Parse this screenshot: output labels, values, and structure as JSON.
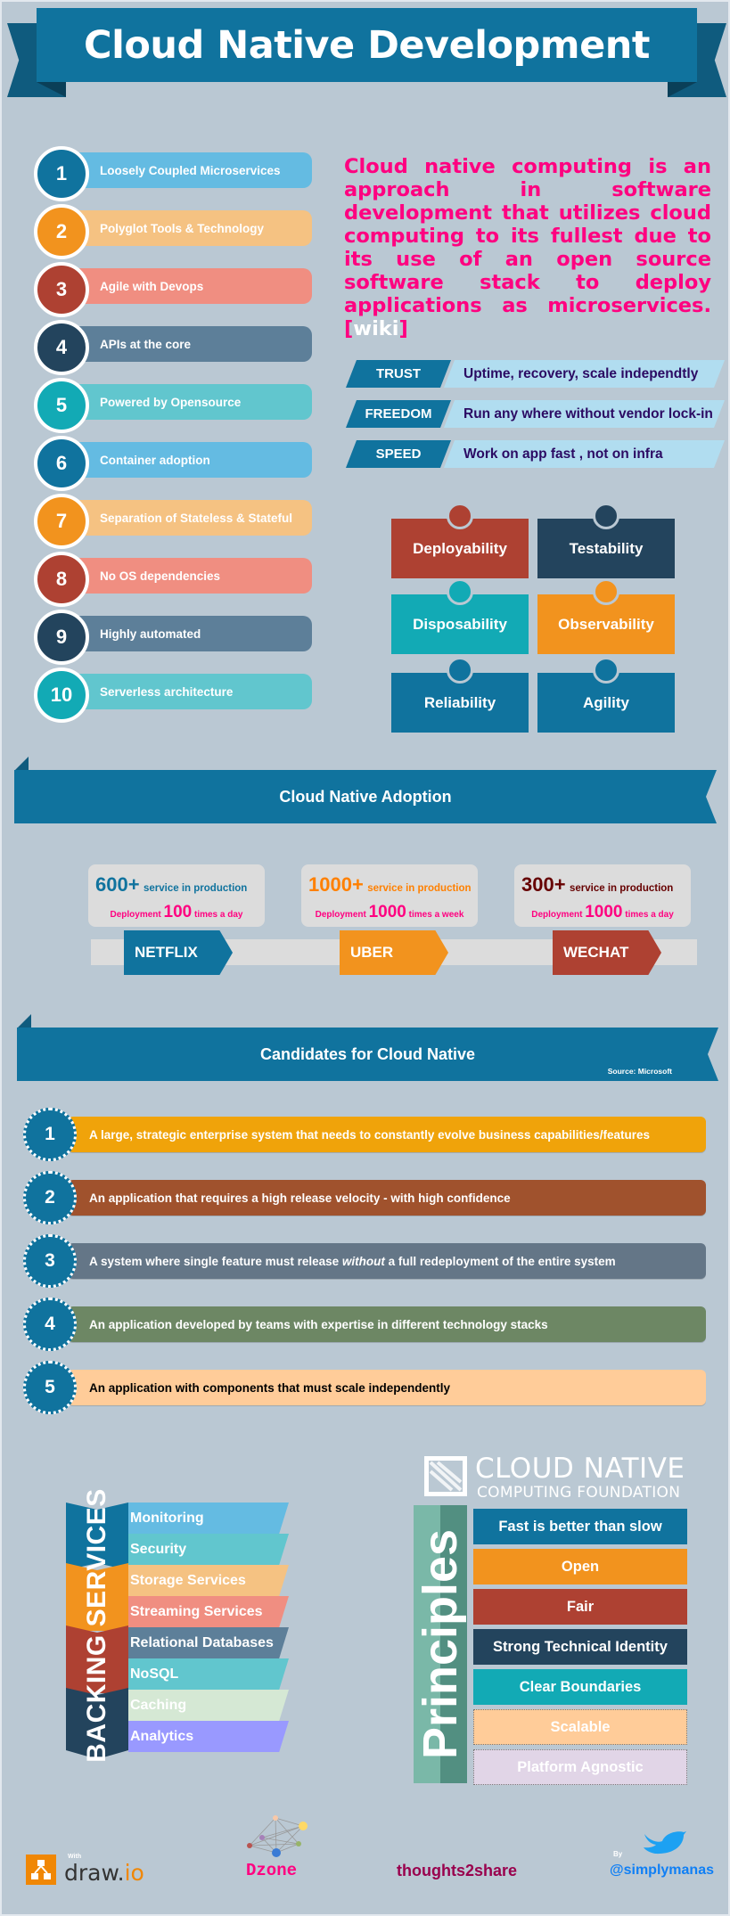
{
  "title": "Cloud Native Development",
  "traits": [
    {
      "num": "1",
      "label": "Loosely Coupled Microservices",
      "circle": "#10739e",
      "bar": "#64bbe2"
    },
    {
      "num": "2",
      "label": "Polyglot Tools & Technology",
      "circle": "#f2931e",
      "bar": "#f5c282"
    },
    {
      "num": "3",
      "label": "Agile with Devops",
      "circle": "#ae4132",
      "bar": "#f08e81"
    },
    {
      "num": "4",
      "label": "APIs at the core",
      "circle": "#23445d",
      "bar": "#5d7f99"
    },
    {
      "num": "5",
      "label": "Powered by Opensource",
      "circle": "#12aab5",
      "bar": "#61c6ce"
    },
    {
      "num": "6",
      "label": "Container adoption",
      "circle": "#10739e",
      "bar": "#64bbe2"
    },
    {
      "num": "7",
      "label": "Separation of Stateless & Stateful",
      "circle": "#f2931e",
      "bar": "#f5c282"
    },
    {
      "num": "8",
      "label": "No OS dependencies",
      "circle": "#ae4132",
      "bar": "#f08e81"
    },
    {
      "num": "9",
      "label": "Highly automated",
      "circle": "#23445d",
      "bar": "#5d7f99"
    },
    {
      "num": "10",
      "label": "Serverless architecture",
      "circle": "#12aab5",
      "bar": "#61c6ce"
    }
  ],
  "definition": {
    "text": "Cloud native computing is an approach in software development that utilizes cloud computing to its fullest due to its use of an open source software stack to deploy applications as microservices. ",
    "bracket_open": "[",
    "link": "wiki",
    "bracket_close": "]"
  },
  "pillars": [
    {
      "key": "TRUST",
      "value": "Uptime, recovery, scale independtly"
    },
    {
      "key": "FREEDOM",
      "value": "Run any where without vendor lock-in"
    },
    {
      "key": "SPEED",
      "value": "Work on app fast , not on infra"
    }
  ],
  "qualities": [
    {
      "label": "Deployability",
      "color": "#ae4132"
    },
    {
      "label": "Testability",
      "color": "#23445d"
    },
    {
      "label": "Disposability",
      "color": "#12aab5"
    },
    {
      "label": "Observability",
      "color": "#f2931e"
    },
    {
      "label": "Reliability",
      "color": "#10739e"
    },
    {
      "label": "Agility",
      "color": "#10739e"
    }
  ],
  "adoption": {
    "heading": "Cloud Native Adoption",
    "companies": [
      {
        "name": "NETFLIX",
        "services": "600+",
        "services_label": "service in production",
        "deploy_prefix": "Deployment",
        "deploy_count": "100",
        "deploy_suffix": "times a day",
        "color": "#10739e",
        "big_color": "#10739e"
      },
      {
        "name": "UBER",
        "services": "1000+",
        "services_label": "service in production",
        "deploy_prefix": "Deployment",
        "deploy_count": "1000",
        "deploy_suffix": "times a week",
        "color": "#f2931e",
        "big_color": "#ff8000"
      },
      {
        "name": "WECHAT",
        "services": "300+",
        "services_label": "service in production",
        "deploy_prefix": "Deployment",
        "deploy_count": "1000",
        "deploy_suffix": "times a day",
        "color": "#ae4132",
        "big_color": "#660000"
      }
    ]
  },
  "candidates": {
    "heading": "Candidates for Cloud Native",
    "source": "Source: Microsoft",
    "items": [
      {
        "num": "1",
        "pre": "A large, strategic enterprise system that needs to constantly evolve business capabilities/features",
        "em": "",
        "post": "",
        "color": "#f0a30a",
        "text_color": "#ffffff"
      },
      {
        "num": "2",
        "pre": "An application that requires a high release velocity - with high confidence",
        "em": "",
        "post": "",
        "color": "#a0522d",
        "text_color": "#ffffff"
      },
      {
        "num": "3",
        "pre": "A system where single feature must release ",
        "em": "without",
        "post": " a full redeployment of the entire system",
        "color": "#647687",
        "text_color": "#ffffff"
      },
      {
        "num": "4",
        "pre": "An application developed by teams with expertise in different technology stacks",
        "em": "",
        "post": "",
        "color": "#6d8764",
        "text_color": "#ffffff"
      },
      {
        "num": "5",
        "pre": "An application with components that must scale independently",
        "em": "",
        "post": "",
        "color": "#ffcc99",
        "text_color": "#000000"
      }
    ]
  },
  "backing_services": {
    "label": "BACKING SERVICES",
    "items": [
      {
        "label": "Monitoring",
        "color": "#64bbe2"
      },
      {
        "label": "Security",
        "color": "#61c6ce"
      },
      {
        "label": "Storage Services",
        "color": "#f5c282"
      },
      {
        "label": "Streaming Services",
        "color": "#f08e81"
      },
      {
        "label": "Relational Databases",
        "color": "#5d7f99"
      },
      {
        "label": "NoSQL",
        "color": "#61c6ce"
      },
      {
        "label": "Caching",
        "color": "#d5e8d4"
      },
      {
        "label": "Analytics",
        "color": "#9999ff"
      }
    ]
  },
  "cncf": {
    "line1": "CLOUD NATIVE",
    "line2": "COMPUTING FOUNDATION",
    "pillar_label": "Principles",
    "principles": [
      {
        "label": "Fast is better than slow",
        "color": "#10739e"
      },
      {
        "label": "Open",
        "color": "#f2931e"
      },
      {
        "label": "Fair",
        "color": "#ae4132"
      },
      {
        "label": "Strong Technical Identity",
        "color": "#23445d"
      },
      {
        "label": "Clear Boundaries",
        "color": "#12aab5"
      },
      {
        "label": "Scalable",
        "color": "#ffcc99"
      },
      {
        "label": "Platform Agnostic",
        "color": "#e1d5e7"
      }
    ]
  },
  "footer": {
    "with_label": "With",
    "drawio_name": "draw.",
    "drawio_suffix": "io",
    "dzone": "Dzone",
    "thoughts": "thoughts2share",
    "by_label": "By",
    "handle": "@simplymanas"
  }
}
